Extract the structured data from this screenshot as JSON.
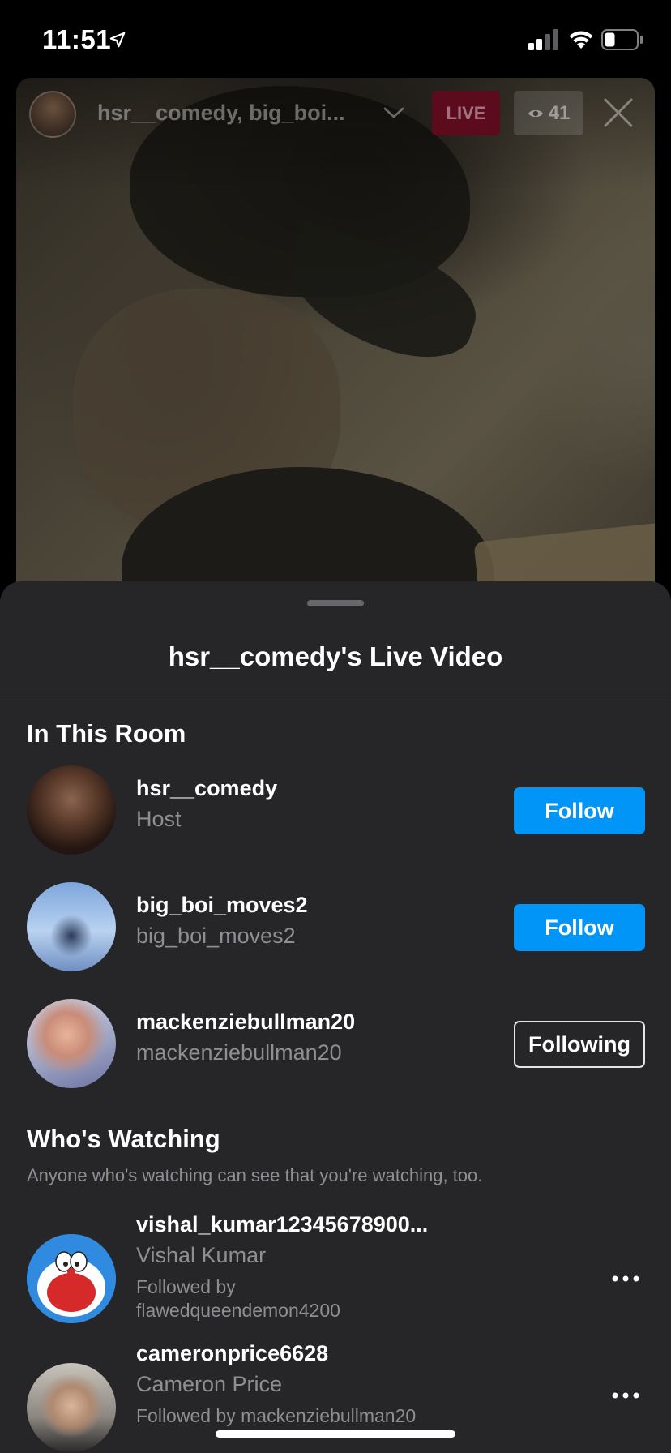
{
  "status_bar": {
    "time": "11:51"
  },
  "live": {
    "title": "hsr__comedy, big_boi...",
    "live_label": "LIVE",
    "viewer_count": "41"
  },
  "sheet": {
    "title": "hsr__comedy's Live Video",
    "in_room_heading": "In This Room",
    "room_members": [
      {
        "username": "hsr__comedy",
        "subtitle": "Host",
        "button": "Follow"
      },
      {
        "username": "big_boi_moves2",
        "subtitle": "big_boi_moves2",
        "button": "Follow"
      },
      {
        "username": "mackenziebullman20",
        "subtitle": "mackenziebullman20",
        "button": "Following"
      }
    ],
    "watching_heading": "Who's Watching",
    "watching_note": "Anyone who's watching can see that you're watching, too.",
    "viewers": [
      {
        "username": "vishal_kumar12345678900...",
        "full_name": "Vishal Kumar",
        "followed_by_line1": "Followed by",
        "followed_by_line2": "flawedqueendemon4200"
      },
      {
        "username": "cameronprice6628",
        "full_name": "Cameron Price",
        "followed_by": "Followed by mackenziebullman20"
      }
    ]
  },
  "colors": {
    "follow_blue": "#0095f6",
    "sheet_bg": "#262628",
    "secondary_text": "#8e8e93",
    "live_badge": "#5b0b1c"
  },
  "icons": [
    "location-arrow-icon",
    "signal-icon",
    "wifi-icon",
    "battery-icon",
    "chevron-down-icon",
    "eye-icon",
    "close-icon",
    "more-icon"
  ]
}
